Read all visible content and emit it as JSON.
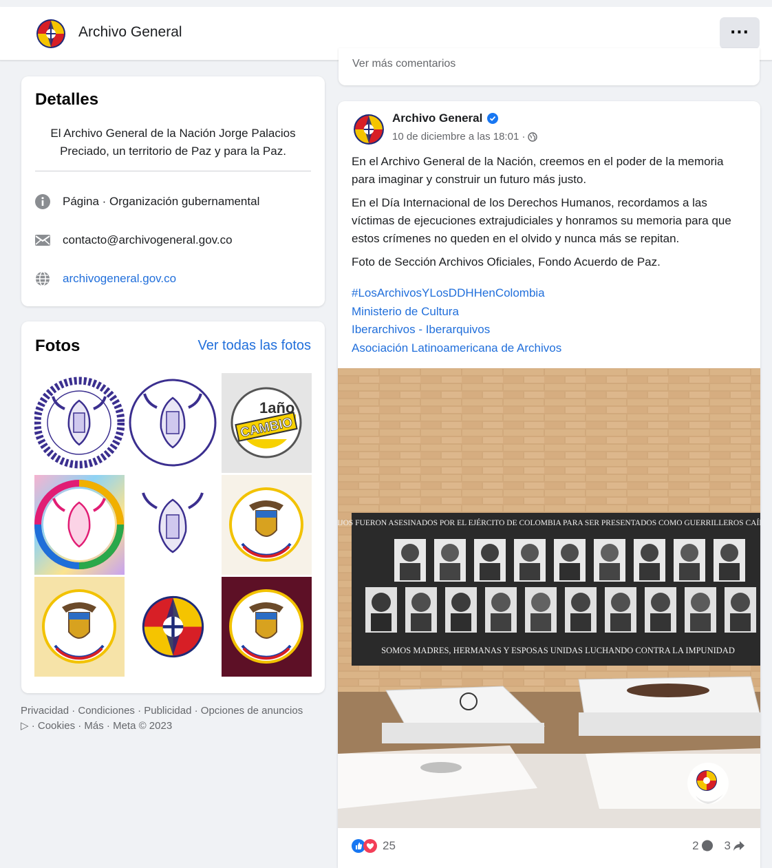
{
  "header": {
    "page_name": "Archivo General",
    "more_label": "···"
  },
  "details": {
    "title": "Detalles",
    "bio": "El Archivo General de la Nación Jorge Palacios Preciado, un territorio de Paz y para la Paz.",
    "category": "Página · Organización gubernamental",
    "email": "contacto@archivogeneral.gov.co",
    "website": "archivogeneral.gov.co"
  },
  "photos": {
    "title": "Fotos",
    "see_all": "Ver todas las fotos",
    "tile3_text_1": "1año",
    "tile3_text_2": "CAMBIO"
  },
  "footer": {
    "line1": "Privacidad · Condiciones · Publicidad · Opciones de anuncios",
    "line2": "· Cookies · Más · Meta © 2023"
  },
  "previous_post": {
    "more_comments": "Ver más comentarios"
  },
  "post": {
    "author": "Archivo General",
    "timestamp": "10 de diciembre a las 18:01 ·",
    "paragraph1": "En el Archivo General de la Nación, creemos en el poder de la memoria para imaginar y construir un futuro más justo.",
    "paragraph2": "En el Día Internacional de los Derechos Humanos, recordamos a las víctimas de ejecuciones extrajudiciales y honramos su memoria para que estos crímenes no queden en el olvido y nunca más se repitan.",
    "paragraph3": "Foto de Sección Archivos Oficiales, Fondo Acuerdo de Paz.",
    "tags": [
      "#LosArchivosYLosDDHHenColombia",
      "Ministerio de Cultura",
      "Iberarchivos - Iberarquivos",
      "Asociación Latinoamericana de Archivos"
    ],
    "banner_top": "NUESTROS HIJOS FUERON ASESINADOS POR EL EJÉRCITO DE COLOMBIA PARA SER PRESENTADOS COMO GUERRILLEROS CAÍDOS EN COMBATE",
    "banner_bottom": "SOMOS MADRES, HERMANAS Y ESPOSAS UNIDAS LUCHANDO CONTRA LA IMPUNIDAD",
    "reactions_count": "25",
    "comments_count": "2",
    "shares_count": "3"
  },
  "colors": {
    "link": "#216fdb",
    "secondary_text": "#65676b",
    "background": "#f0f2f5"
  }
}
